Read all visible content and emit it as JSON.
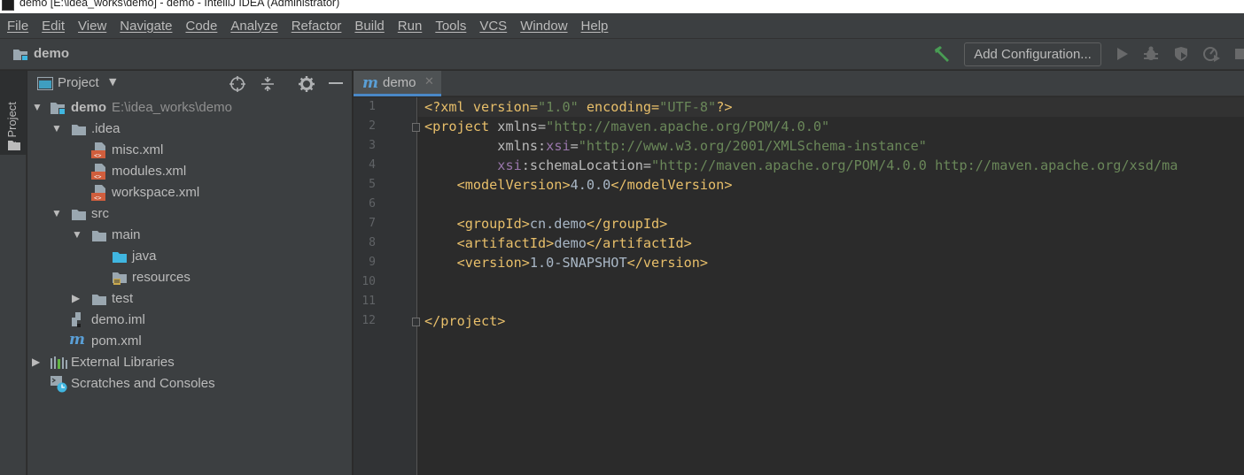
{
  "window": {
    "title": "demo [E:\\idea_works\\demo] - demo - IntelliJ IDEA (Administrator)"
  },
  "menu": [
    "File",
    "Edit",
    "View",
    "Navigate",
    "Code",
    "Analyze",
    "Refactor",
    "Build",
    "Run",
    "Tools",
    "VCS",
    "Window",
    "Help"
  ],
  "navbar": {
    "breadcrumb": "demo",
    "add_configuration": "Add Configuration..."
  },
  "toolwindow": {
    "stripe_label": "1: Project",
    "title": "Project"
  },
  "tree": [
    {
      "label": "demo",
      "path": "E:\\idea_works\\demo",
      "icon": "module-folder-icon",
      "expanded": true
    },
    {
      "label": ".idea",
      "icon": "folder-icon",
      "expanded": true
    },
    {
      "label": "misc.xml",
      "icon": "xml-file-icon"
    },
    {
      "label": "modules.xml",
      "icon": "xml-file-icon"
    },
    {
      "label": "workspace.xml",
      "icon": "xml-file-icon"
    },
    {
      "label": "src",
      "icon": "folder-icon",
      "expanded": true
    },
    {
      "label": "main",
      "icon": "folder-icon",
      "expanded": true
    },
    {
      "label": "java",
      "icon": "source-folder-icon"
    },
    {
      "label": "resources",
      "icon": "resources-folder-icon"
    },
    {
      "label": "test",
      "icon": "folder-icon",
      "expanded": false
    },
    {
      "label": "demo.iml",
      "icon": "iml-file-icon"
    },
    {
      "label": "pom.xml",
      "icon": "maven-file-icon"
    },
    {
      "label": "External Libraries",
      "icon": "libraries-icon",
      "expanded": false
    },
    {
      "label": "Scratches and Consoles",
      "icon": "scratches-icon"
    }
  ],
  "editor": {
    "tab": {
      "name": "demo",
      "icon": "maven-file-icon"
    },
    "line_numbers": [
      "1",
      "2",
      "3",
      "4",
      "5",
      "6",
      "7",
      "8",
      "9",
      "10",
      "11",
      "12"
    ],
    "code": {
      "l1_a": "<?xml version=",
      "l1_b": "\"1.0\"",
      "l1_c": " encoding=",
      "l1_d": "\"UTF-8\"",
      "l1_e": "?>",
      "l2_tag": "<project ",
      "l2_attr": "xmlns=",
      "l2_val": "\"http://maven.apache.org/POM/4.0.0\"",
      "l3_indent": "         ",
      "l3_attr": "xmlns:",
      "l3_ns": "xsi",
      "l3_eq": "=",
      "l3_val": "\"http://www.w3.org/2001/XMLSchema-instance\"",
      "l4_indent": "         ",
      "l4_ns": "xsi",
      "l4_attr": ":schemaLocation=",
      "l4_val": "\"http://maven.apache.org/POM/4.0.0 http://maven.apache.org/xsd/ma",
      "l5_indent": "    ",
      "l5_open": "<modelVersion>",
      "l5_text": "4.0.0",
      "l5_close": "</modelVersion>",
      "l7_indent": "    ",
      "l7_open": "<groupId>",
      "l7_text": "cn.demo",
      "l7_close": "</groupId>",
      "l8_indent": "    ",
      "l8_open": "<artifactId>",
      "l8_text": "demo",
      "l8_close": "</artifactId>",
      "l9_indent": "    ",
      "l9_open": "<version>",
      "l9_text": "1.0-SNAPSHOT",
      "l9_close": "</version>",
      "l12_close": "</project>"
    }
  }
}
